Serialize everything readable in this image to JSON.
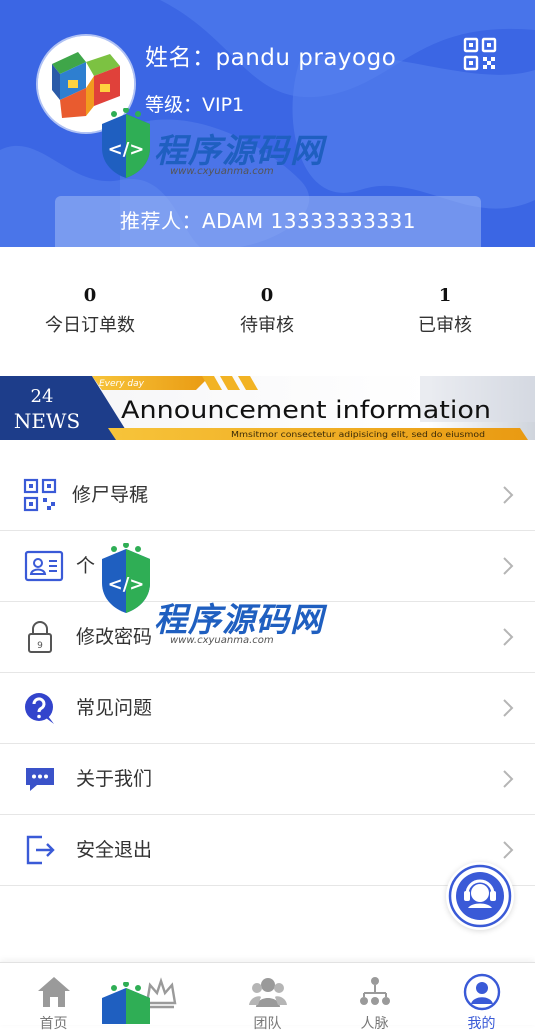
{
  "profile": {
    "name": "姓名：pandu prayogo",
    "level": "等级：VIP1",
    "referrer": "推荐人：ADAM  13333333331"
  },
  "stats": [
    {
      "value": "0",
      "label": "今日订单数"
    },
    {
      "value": "0",
      "label": "待审核"
    },
    {
      "value": "1",
      "label": "已审核"
    }
  ],
  "banner": {
    "badge_number": "24",
    "badge_word": "NEWS",
    "tag": "Every day",
    "title": "Announcement information",
    "subtitle": "Mmsitmor consectetur adipisicing elit, sed do eiusmod"
  },
  "menu": [
    {
      "label": "修尸导䅏",
      "icon": "qr-code-icon"
    },
    {
      "label": "个",
      "icon": "id-card-icon"
    },
    {
      "label": "修改密码",
      "icon": "lock-icon"
    },
    {
      "label": "常见问题",
      "icon": "question-icon"
    },
    {
      "label": "关于我们",
      "icon": "chat-icon"
    },
    {
      "label": "安全退出",
      "icon": "logout-icon"
    }
  ],
  "tabs": [
    {
      "label": "首页",
      "icon": "home-icon"
    },
    {
      "label": "",
      "icon": "crown-icon"
    },
    {
      "label": "团队",
      "icon": "team-icon"
    },
    {
      "label": "人脉",
      "icon": "network-icon"
    },
    {
      "label": "我的",
      "icon": "user-icon",
      "active": true
    }
  ],
  "watermark": {
    "brand": "程序源码网",
    "url": "www.cxyuanma.com"
  },
  "colors": {
    "header_blue": "#3b66e4",
    "accent": "#3a5ad7",
    "banner_navy": "#1d3d8a",
    "banner_gold": "#f2b324"
  }
}
